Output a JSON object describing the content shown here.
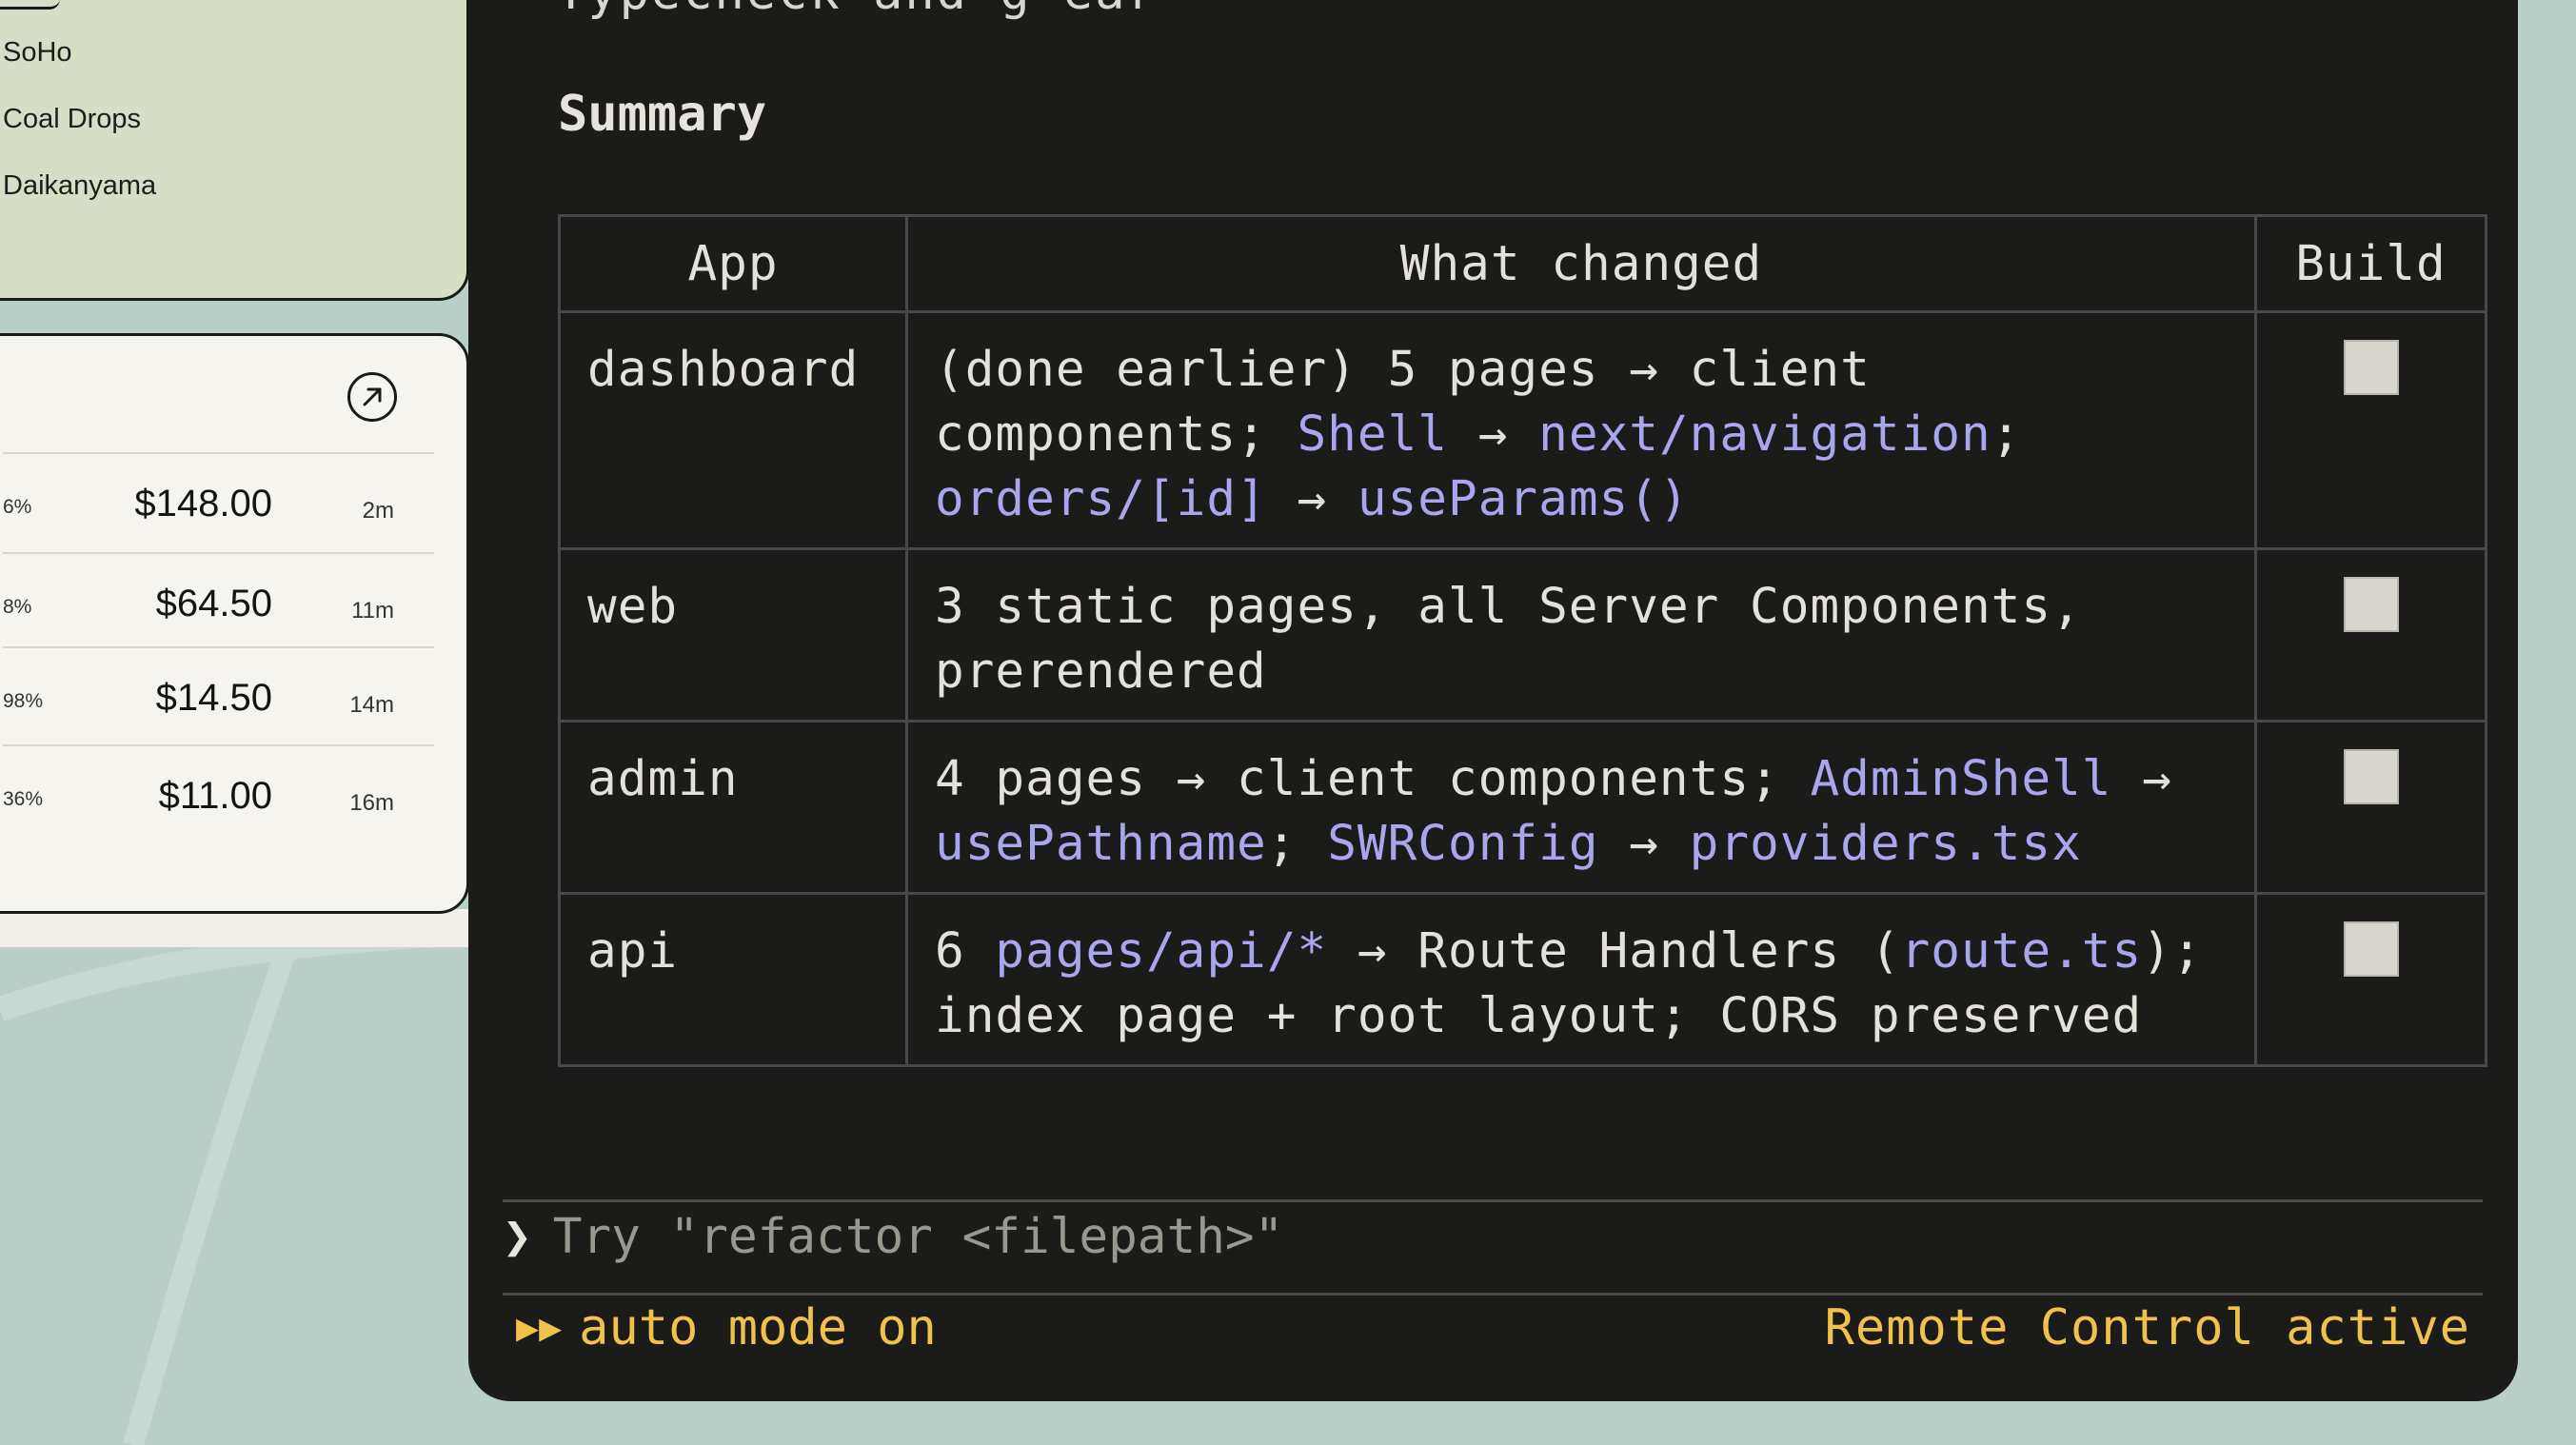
{
  "locations": [
    "SoHo",
    "Coal Drops",
    "Daikanyama"
  ],
  "payments": [
    {
      "pct": "6%",
      "amount": "$148.00",
      "ago": "2m"
    },
    {
      "pct": "8%",
      "amount": "$64.50",
      "ago": "11m"
    },
    {
      "pct": "98%",
      "amount": "$14.50",
      "ago": "14m"
    },
    {
      "pct": "36%",
      "amount": "$11.00",
      "ago": "16m"
    }
  ],
  "terminal": {
    "cut_text": "Typecheck and g  ear",
    "summary_title": "Summary",
    "table": {
      "headers": [
        "App",
        "What changed",
        "Build"
      ],
      "rows": [
        {
          "app": "dashboard",
          "parts": [
            {
              "t": "(done earlier) 5 pages → client components; "
            },
            {
              "t": "Shell",
              "link": true
            },
            {
              "t": " → "
            },
            {
              "t": "next/navigation",
              "link": true
            },
            {
              "t": "; "
            },
            {
              "t": "orders/[id]",
              "link": true
            },
            {
              "t": " → "
            },
            {
              "t": "useParams()",
              "link": true
            }
          ]
        },
        {
          "app": "web",
          "parts": [
            {
              "t": "3 static pages, all Server Components, prerendered"
            }
          ]
        },
        {
          "app": "admin",
          "parts": [
            {
              "t": "4 pages → client components; "
            },
            {
              "t": "AdminShell",
              "link": true
            },
            {
              "t": " → "
            },
            {
              "t": "usePathname",
              "link": true
            },
            {
              "t": "; "
            },
            {
              "t": "SWRConfig",
              "link": true
            },
            {
              "t": " → "
            },
            {
              "t": "providers.tsx",
              "link": true
            }
          ]
        },
        {
          "app": "api",
          "parts": [
            {
              "t": "6 "
            },
            {
              "t": "pages/api/*",
              "link": true
            },
            {
              "t": " → Route Handlers ("
            },
            {
              "t": "route.ts",
              "link": true
            },
            {
              "t": "); index page + root layout; CORS preserved"
            }
          ]
        }
      ]
    },
    "prompt_caret": "❯",
    "prompt_placeholder": "Try \"refactor <filepath>\"",
    "mode_glyph": "▶▶",
    "mode_label": "auto mode on",
    "remote_status": "Remote Control active"
  },
  "colors": {
    "terminal_bg": "#1b1b1a",
    "link": "#a9a6ee",
    "status": "#f0c24b",
    "card_green": "#d6dfc6",
    "card_cream": "#f6f4ee"
  }
}
